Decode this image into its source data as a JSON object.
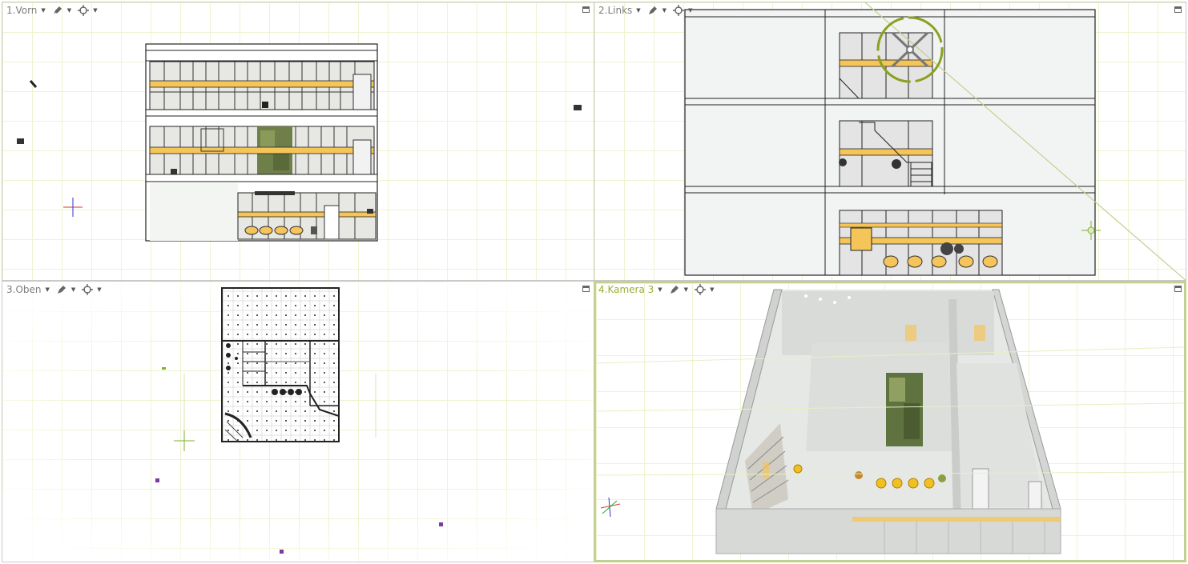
{
  "viewports": [
    {
      "id": "front",
      "title": "1.Vorn",
      "icons": [
        "pen-icon",
        "crosshair-icon"
      ]
    },
    {
      "id": "left",
      "title": "2.Links",
      "icons": [
        "pen-icon",
        "crosshair-icon"
      ]
    },
    {
      "id": "top",
      "title": "3.Oben",
      "icons": [
        "pen-icon",
        "crosshair-icon"
      ]
    },
    {
      "id": "camera",
      "title": "4.Kamera 3",
      "icons": [
        "pen-icon",
        "crosshair-icon"
      ],
      "active": true
    }
  ],
  "colors": {
    "grid": "#eef4cf",
    "active_border": "#c3d08f",
    "active_title": "#9aae36",
    "accent_stripe": "#f5c55a",
    "glass": "#e4e4e4"
  }
}
